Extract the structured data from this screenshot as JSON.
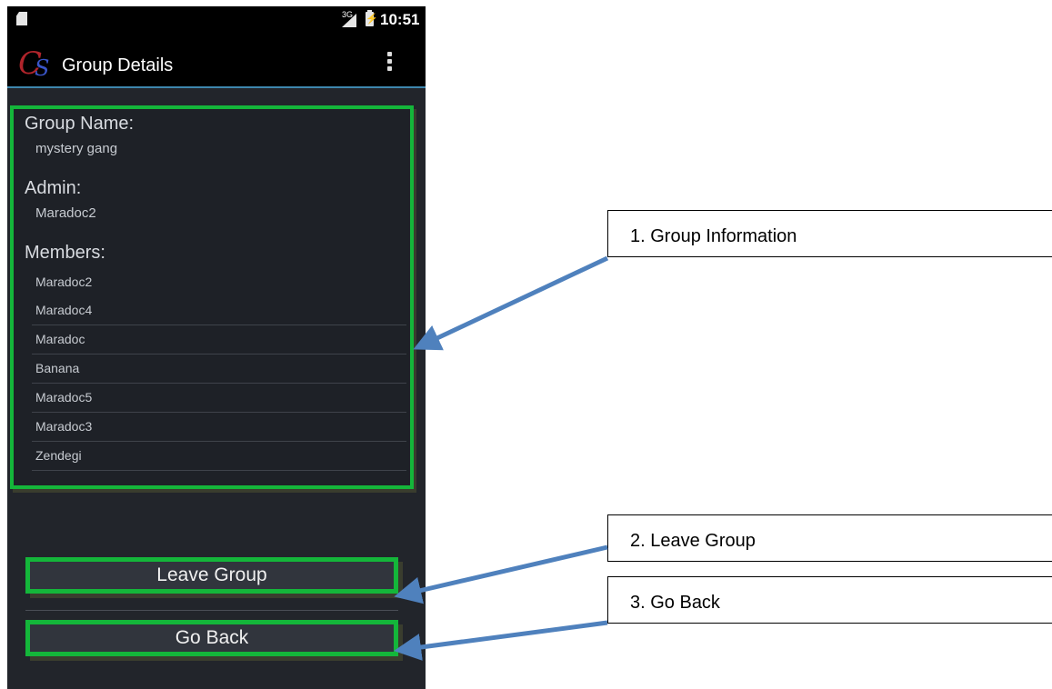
{
  "status_bar": {
    "network": "3G",
    "time": "10:51"
  },
  "action_bar": {
    "logo_text": "CS",
    "title": "Group Details",
    "overflow_icon": "overflow-menu-icon"
  },
  "group_info": {
    "name_heading": "Group Name:",
    "name_value": "mystery gang",
    "admin_heading": "Admin:",
    "admin_value": "Maradoc2",
    "members_heading": "Members:",
    "members": [
      "Maradoc2",
      "Maradoc4",
      "Maradoc",
      "Banana",
      "Maradoc5",
      "Maradoc3",
      "Zendegi"
    ]
  },
  "buttons": {
    "leave_group": "Leave Group",
    "go_back": "Go Back"
  },
  "annotations": [
    "1. Group Information",
    "2. Leave Group",
    "3. Go Back"
  ],
  "colors": {
    "highlight_green": "#14b63a",
    "arrow_blue": "#4f81bd",
    "accent_line": "#3e86ad"
  }
}
